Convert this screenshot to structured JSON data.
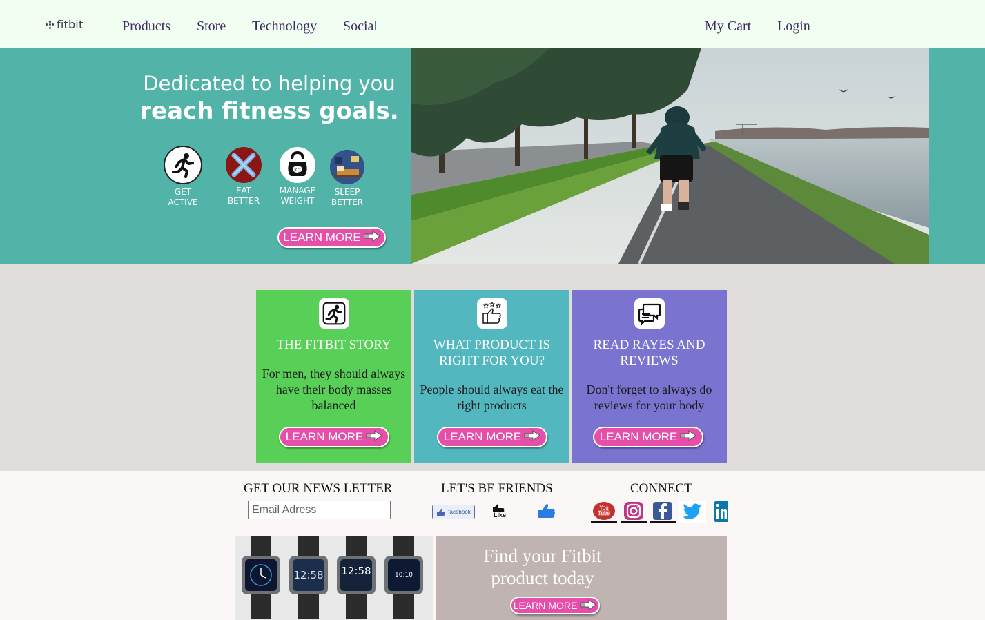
{
  "nav": {
    "logo_text": "fitbit",
    "links": [
      "Products",
      "Store",
      "Technology",
      "Social"
    ],
    "cart": "My Cart",
    "login": "Login"
  },
  "hero": {
    "line1": "Dedicated to helping you",
    "line2": "reach fitness goals.",
    "features": [
      {
        "line1": "GET",
        "line2": "ACTIVE",
        "icon": "running-person-icon"
      },
      {
        "line1": "EAT",
        "line2": "BETTER",
        "icon": "fork-knife-icon"
      },
      {
        "line1": "MANAGE",
        "line2": "WEIGHT",
        "icon": "kettlebell-icon"
      },
      {
        "line1": "SLEEP",
        "line2": "BETTER",
        "icon": "bedroom-icon"
      }
    ],
    "button": "LEARN MORE"
  },
  "cards": [
    {
      "title": "THE FITBIT STORY",
      "text": "For men, they should always have their body masses balanced",
      "button": "LEARN MORE",
      "color": "#58cf56",
      "icon": "running-person-icon"
    },
    {
      "title": "WHAT PRODUCT IS RIGHT FOR YOU?",
      "text": "People should always eat the right products",
      "button": "LEARN MORE",
      "color": "#53b7bf",
      "icon": "thumbs-up-stars-icon"
    },
    {
      "title": "READ RAYES AND REVIEWS",
      "text": "Don't forget to always do reviews for your body",
      "button": "LEARN MORE",
      "color": "#7a73d0",
      "icon": "chat-bubbles-icon"
    }
  ],
  "footer": {
    "newsletter_title": "GET OUR NEWS LETTER",
    "email_placeholder": "Email Adress",
    "friends_title": "LET'S BE FRIENDS",
    "facebook_badge": "facebook",
    "like_text": "Like",
    "connect_title": "CONNECT",
    "connect_icons": [
      "youtube-icon",
      "instagram-icon",
      "facebook-icon",
      "twitter-icon",
      "linkedin-icon"
    ],
    "youtube_badge": "You Tube"
  },
  "promo": {
    "text": "Find your Fitbit product today",
    "button": "LEARN MORE",
    "watch_times": [
      "",
      "12:58",
      "12:58",
      "10:10"
    ]
  },
  "colors": {
    "accent_pink": "#e64fa9",
    "teal": "#52b3a9",
    "nav_text": "#3f2b64"
  }
}
